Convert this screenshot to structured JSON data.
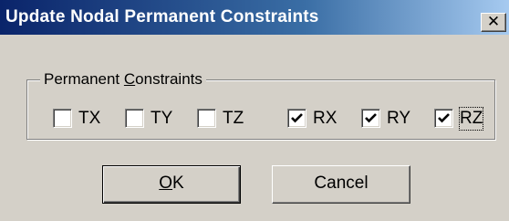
{
  "window": {
    "title": "Update Nodal Permanent Constraints",
    "close_glyph": "✕"
  },
  "group": {
    "label_prefix": "Permanent ",
    "label_mnemonic": "C",
    "label_suffix": "onstraints"
  },
  "checkboxes": [
    {
      "label": "TX",
      "checked": false
    },
    {
      "label": "TY",
      "checked": false
    },
    {
      "label": "TZ",
      "checked": false
    },
    {
      "label": "RX",
      "checked": true
    },
    {
      "label": "RY",
      "checked": true
    },
    {
      "label": "RZ",
      "checked": true,
      "focused": true
    }
  ],
  "buttons": {
    "ok_mnemonic": "O",
    "ok_rest": "K",
    "cancel_label": "Cancel"
  },
  "colors": {
    "dialog_face": "#d4d0c8",
    "title_start": "#0a246a",
    "title_end": "#a6caf0",
    "title_text": "#ffffff"
  }
}
